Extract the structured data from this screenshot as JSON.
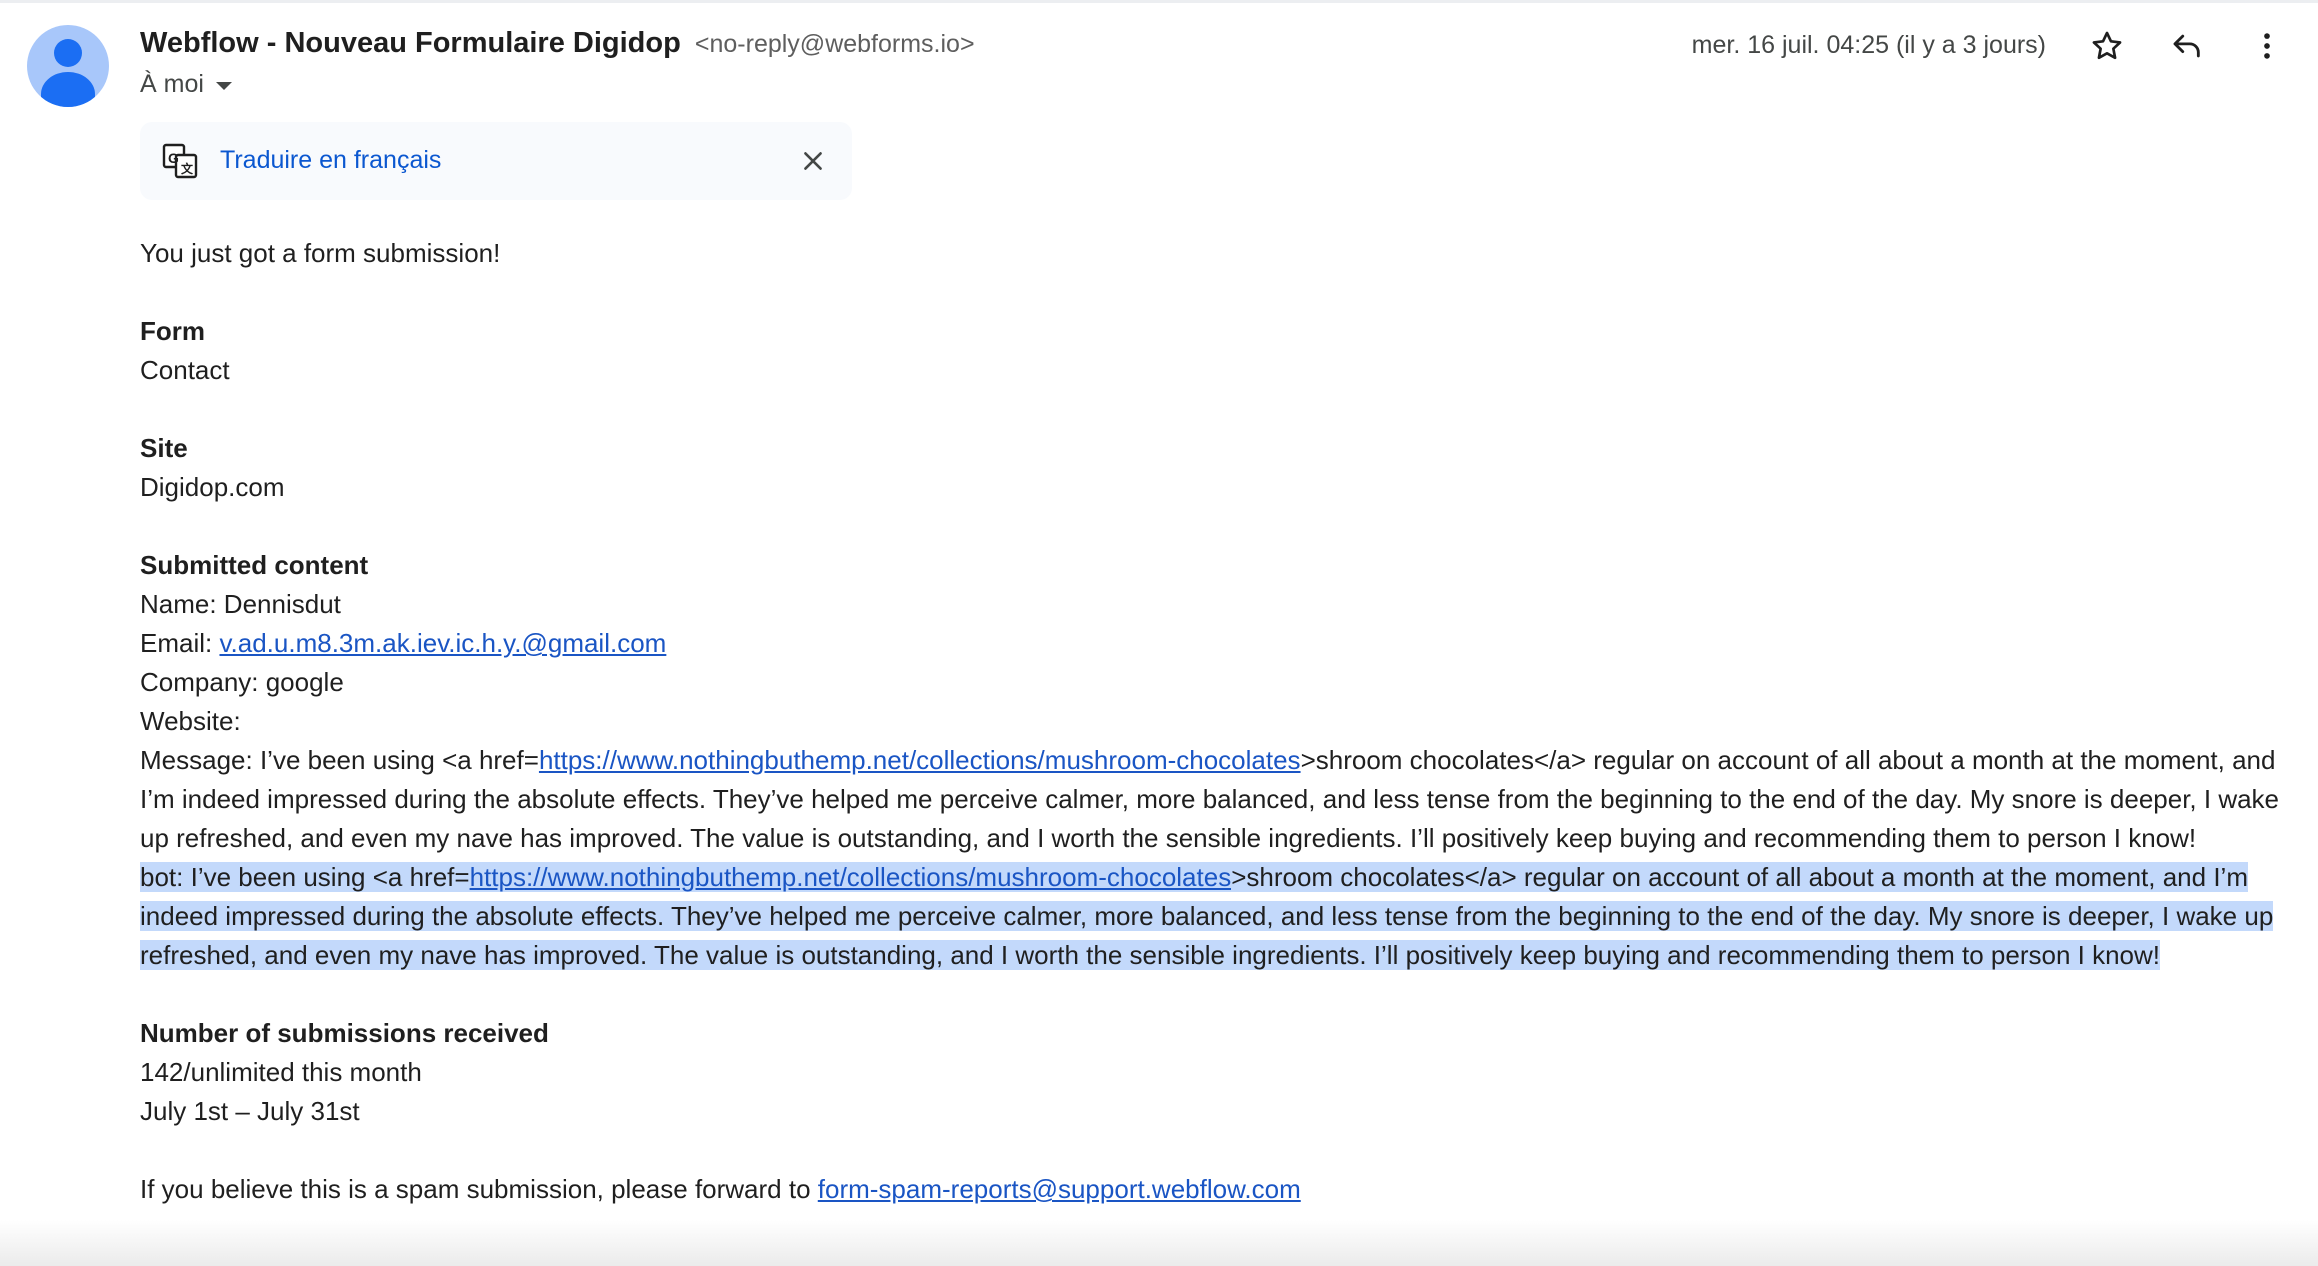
{
  "header": {
    "sender_name": "Webflow - Nouveau Formulaire Digidop",
    "sender_email": "<no-reply@webforms.io>",
    "recipient": "À moi",
    "date": "mer. 16 juil. 04:25 (il y a 3 jours)"
  },
  "icons": {
    "avatar": "person-icon",
    "star": "star-outline-icon",
    "reply": "reply-icon",
    "more": "more-vertical-icon",
    "translate": "translate-icon",
    "close": "close-icon"
  },
  "translate": {
    "label": "Traduire en français"
  },
  "body": {
    "intro": "You just got a form submission!",
    "form_label": "Form",
    "form_value": "Contact",
    "site_label": "Site",
    "site_value": "Digidop.com",
    "submitted_label": "Submitted content",
    "name_line": "Name: Dennisdut",
    "email_prefix": "Email: ",
    "email_link": "v.ad.u.m8.3m.ak.iev.ic.h.y.@gmail.com",
    "company_line": "Company: google",
    "website_line": "Website:",
    "message_prefix": "Message: I’ve been using <a href=",
    "message_link": "https://www.nothingbuthemp.net/collections/mushroom-chocolates",
    "message_rest": ">shroom chocolates</a> regular on account of all about a month at the moment, and I’m indeed impressed during the absolute effects. They’ve helped me perceive calmer, more balanced, and less tense from the beginning to the end of the day. My snore is deeper, I wake up refreshed, and even my nave has improved. The value is outstanding, and I worth the sensible ingredients. I’ll positively keep buying and recommending them to person I know!",
    "bot_prefix": "bot: I’ve been using <a href=",
    "bot_link": "https://www.nothingbuthemp.net/collections/mushroom-chocolates",
    "bot_rest": ">shroom chocolates</a> regular on account of all about a month at the moment, and I’m indeed impressed during the absolute effects. They’ve helped me perceive calmer, more balanced, and less tense from the beginning to the end of the day. My snore is deeper, I wake up refreshed, and even my nave has improved. The value is outstanding, and I worth the sensible ingredients. I’ll positively keep buying and recommending them to person I know!",
    "submissions_label": "Number of submissions received",
    "submissions_count": "142/unlimited this month",
    "submissions_period": "July 1st – July 31st",
    "spam_prefix": "If you believe this is a spam submission, please forward to ",
    "spam_link": "form-spam-reports@support.webflow.com"
  },
  "colors": {
    "link": "#1a55c4",
    "translate_link": "#0b57d0",
    "selection": "#c3d9fb",
    "avatar_bg": "#a8c7fa",
    "avatar_fg": "#1b6ef3"
  }
}
